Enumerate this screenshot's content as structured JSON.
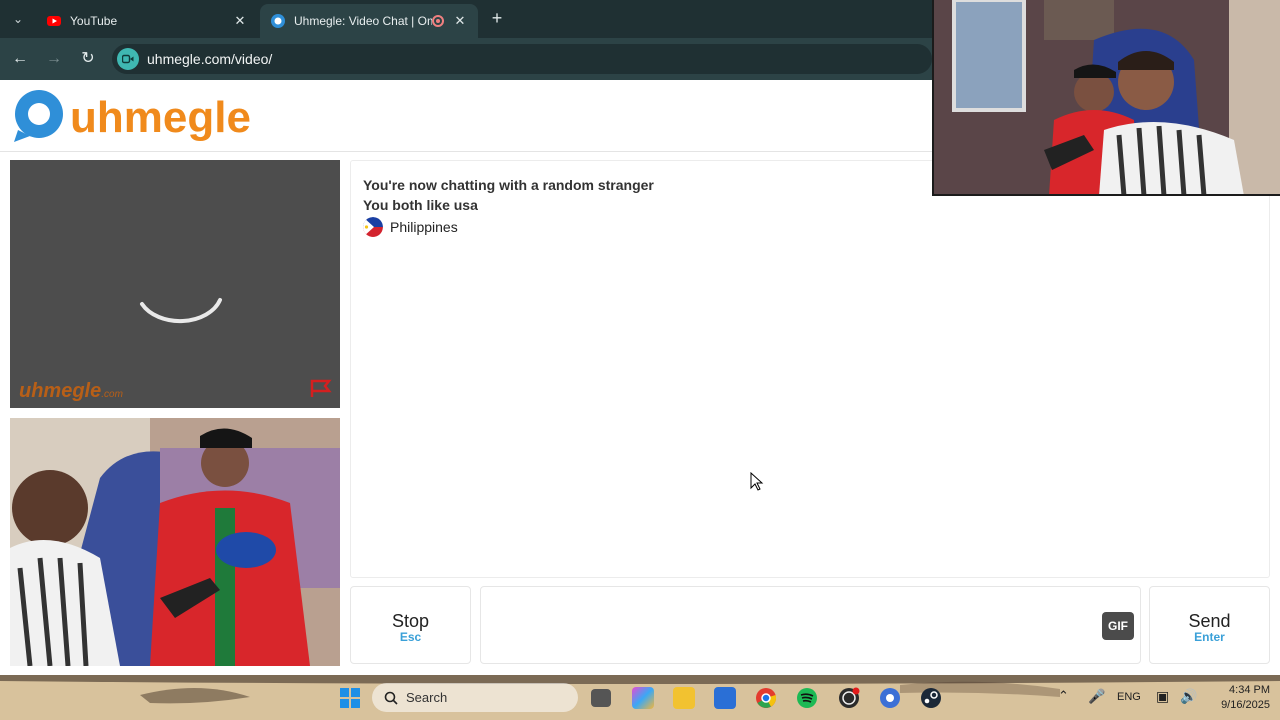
{
  "browser": {
    "tabs": [
      {
        "title": "YouTube",
        "favicon": "youtube-icon",
        "active": false
      },
      {
        "title": "Uhmegle: Video Chat | Omegle",
        "favicon": "uhmegle-favicon-icon",
        "active": true,
        "recording": true
      }
    ],
    "new_tab": "+",
    "address": "uhmegle.com/video/"
  },
  "site": {
    "logo_text": "uhmegle",
    "watermark": "uhmegle",
    "watermark_suffix": ".com"
  },
  "chat": {
    "messages": [
      "You're now chatting with a random stranger",
      "You both like usa"
    ],
    "country": "Philippines"
  },
  "controls": {
    "stop_label": "Stop",
    "stop_hint": "Esc",
    "gif_label": "GIF",
    "send_label": "Send",
    "send_hint": "Enter",
    "message_placeholder": ""
  },
  "taskbar": {
    "search_label": "Search",
    "language": "ENG",
    "time": "4:34 PM",
    "date": "9/16/2025"
  },
  "colors": {
    "accent_blue": "#3aa0d8",
    "logo_orange": "#f08a1c",
    "logo_blue": "#2f8fd8"
  }
}
